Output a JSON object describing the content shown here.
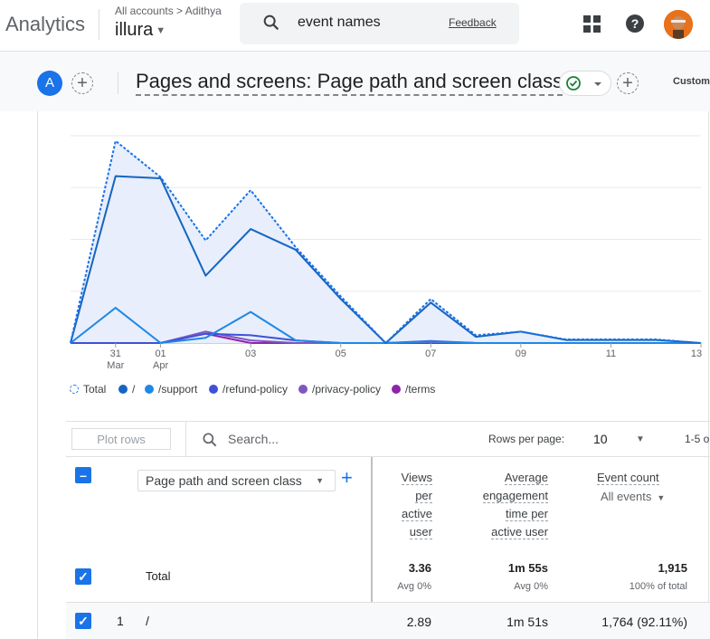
{
  "header": {
    "brand": "Analytics",
    "breadcrumb": "All accounts > Adithya",
    "property": "illura",
    "search_text": "event names",
    "feedback": "Feedback"
  },
  "subbar": {
    "segment_letter": "A",
    "report_title": "Pages and screens: Page path and screen class",
    "customize": "Custom"
  },
  "chart_data": {
    "type": "line",
    "x_tick_labels": [
      {
        "day": "31",
        "month": "Mar"
      },
      {
        "day": "01",
        "month": "Apr"
      },
      {
        "day": "03",
        "month": ""
      },
      {
        "day": "05",
        "month": ""
      },
      {
        "day": "07",
        "month": ""
      },
      {
        "day": "09",
        "month": ""
      },
      {
        "day": "11",
        "month": ""
      },
      {
        "day": "13",
        "month": ""
      }
    ],
    "x": [
      "Mar 30",
      "Mar 31",
      "Apr 01",
      "Apr 02",
      "Apr 03",
      "Apr 04",
      "Apr 05",
      "Apr 06",
      "Apr 07",
      "Apr 08",
      "Apr 09",
      "Apr 10",
      "Apr 11",
      "Apr 12",
      "Apr 13"
    ],
    "ylim": [
      0,
      400
    ],
    "grid": true,
    "series": [
      {
        "name": "Total",
        "color": "#1a73e8",
        "dashed": true,
        "fill": "#e8eefc",
        "values": [
          0,
          390,
          320,
          198,
          295,
          185,
          90,
          0,
          85,
          15,
          22,
          7,
          7,
          7,
          0
        ]
      },
      {
        "name": "/",
        "color": "#1565c0",
        "values": [
          0,
          322,
          318,
          130,
          220,
          180,
          85,
          0,
          78,
          12,
          22,
          6,
          6,
          6,
          0
        ]
      },
      {
        "name": "/support",
        "color": "#1e88e5",
        "values": [
          0,
          68,
          0,
          10,
          60,
          5,
          0,
          0,
          3,
          0,
          0,
          0,
          0,
          0,
          0
        ]
      },
      {
        "name": "/refund-policy",
        "color": "#3f51d6",
        "values": [
          0,
          0,
          0,
          18,
          15,
          5,
          0,
          0,
          4,
          0,
          0,
          0,
          0,
          0,
          0
        ]
      },
      {
        "name": "/privacy-policy",
        "color": "#7e57c2",
        "values": [
          0,
          0,
          0,
          22,
          5,
          0,
          0,
          0,
          2,
          0,
          0,
          0,
          0,
          0,
          0
        ]
      },
      {
        "name": "/terms",
        "color": "#8e24aa",
        "values": [
          0,
          0,
          0,
          18,
          0,
          0,
          0,
          0,
          0,
          0,
          0,
          0,
          0,
          0,
          0
        ]
      }
    ]
  },
  "table": {
    "plot_rows": "Plot rows",
    "search_placeholder": "Search...",
    "rows_per_page_label": "Rows per page:",
    "rows_per_page": "10",
    "range": "1-5 o",
    "dimension": "Page path and screen class",
    "columns": {
      "views": [
        "Views",
        "per",
        "active",
        "user"
      ],
      "engagement": [
        "Average",
        "engagement",
        "time per",
        "active user"
      ],
      "event_count": "Event count",
      "event_filter": "All events"
    },
    "total": {
      "label": "Total",
      "views": "3.36",
      "views_sub": "Avg 0%",
      "engagement": "1m 55s",
      "engagement_sub": "Avg 0%",
      "event_count": "1,915",
      "event_count_sub": "100% of total"
    },
    "rows": [
      {
        "index": "1",
        "path": "/",
        "views": "2.89",
        "engagement": "1m 51s",
        "event_count": "1,764 (92.11%)"
      }
    ]
  }
}
